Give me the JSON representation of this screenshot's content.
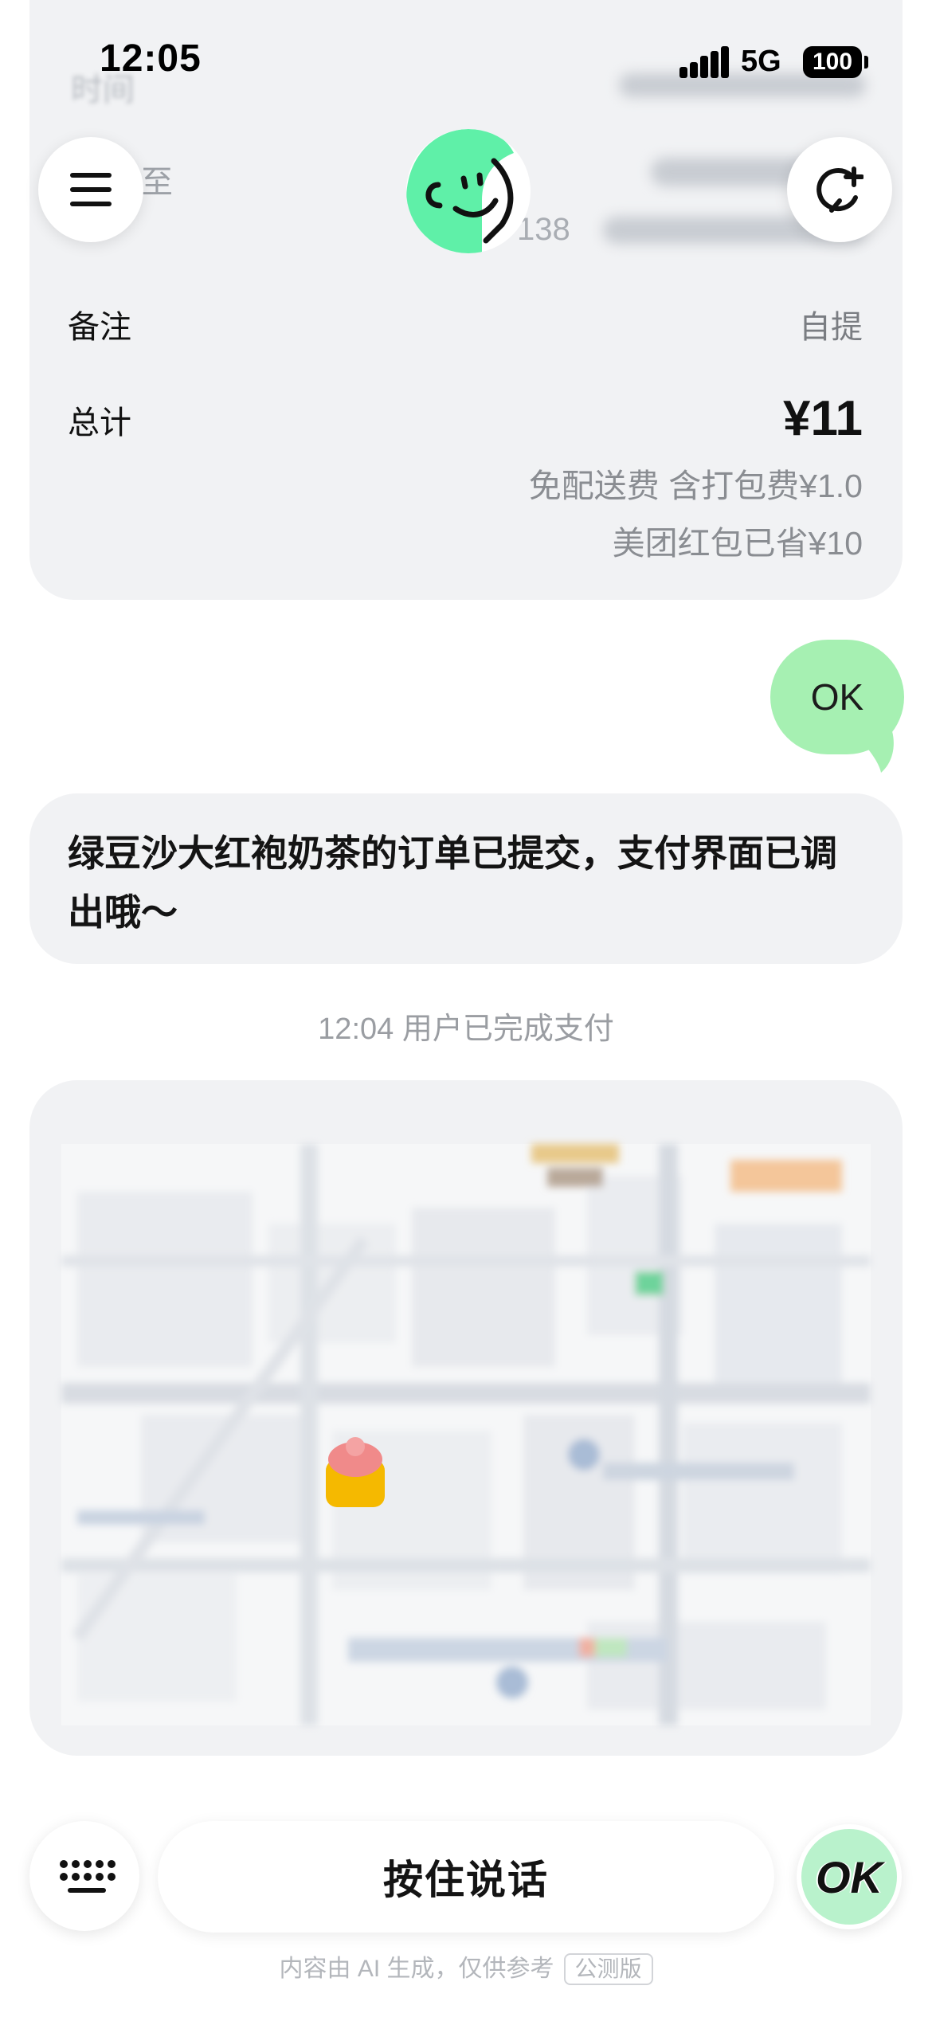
{
  "status_bar": {
    "time": "12:05",
    "network": "5G",
    "battery": "100"
  },
  "order_card": {
    "partial_label": "至",
    "partial_phone": "138",
    "note_label": "备注",
    "note_value": "自提",
    "total_label": "总计",
    "total_value": "¥11",
    "fee_line": "免配送费 含打包费¥1.0",
    "discount_line": "美团红包已省¥10"
  },
  "chat": {
    "user_message": "OK",
    "bot_message": "绿豆沙大红袍奶茶的订单已提交，支付界面已调出哦～",
    "system_note": "12:04 用户已完成支付"
  },
  "input_bar": {
    "talk_label": "按住说话",
    "ok_label": "OK"
  },
  "footer": {
    "disclaimer": "内容由 AI 生成，仅供参考",
    "beta_tag": "公测版"
  },
  "colors": {
    "user_bubble": "#a6f0b2",
    "card_bg": "#f1f2f4",
    "avatar_green": "#5ff0a8",
    "ok_button": "#b9f2cc"
  }
}
